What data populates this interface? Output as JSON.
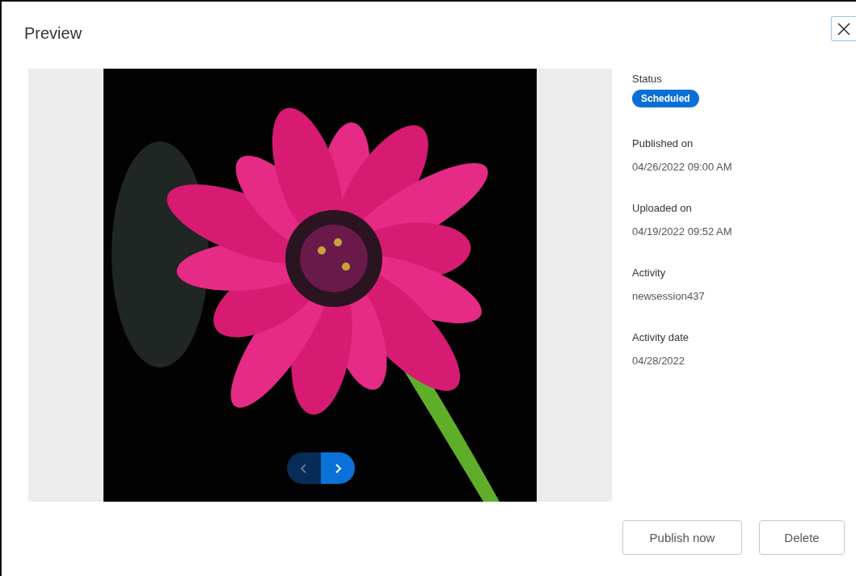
{
  "dialog": {
    "title": "Preview"
  },
  "preview": {
    "kind": "picture",
    "nav": [
      {
        "kind": "prev",
        "disabled": true
      },
      {
        "kind": "next",
        "disabled": false
      }
    ]
  },
  "details": [
    {
      "label": "Status",
      "value": "Scheduled",
      "kind": "badge"
    },
    {
      "label": "Published on",
      "value": "04/26/2022 09:00 AM",
      "kind": "text"
    },
    {
      "label": "Uploaded on",
      "value": "04/19/2022 09:52 AM",
      "kind": "text"
    },
    {
      "label": "Activity",
      "value": "newsession437",
      "kind": "text"
    },
    {
      "label": "Activity date",
      "value": "04/28/2022",
      "kind": "text"
    }
  ],
  "buttons": [
    "Publish now",
    "Delete"
  ]
}
